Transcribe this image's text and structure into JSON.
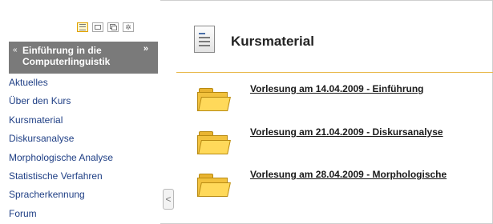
{
  "sidebar": {
    "course_title": "Einführung in die Computerlinguistik",
    "collapse_up_glyph": "«",
    "expand_glyph": "»",
    "nav_items": [
      "Aktuelles",
      "Über den Kurs",
      "Kursmaterial",
      "Diskursanalyse",
      "Morphologische Analyse",
      "Statistische Verfahren",
      "Spracherkennung",
      "Forum"
    ],
    "view_toggle_icons": [
      "list-view-icon",
      "window-view-icon",
      "multi-window-icon",
      "settings-icon"
    ],
    "collapse_button_glyph": "<"
  },
  "main": {
    "title": "Kursmaterial",
    "title_icon": "document-icon",
    "folders": [
      {
        "label": "Vorlesung am 14.04.2009 - Einführung",
        "icon": "folder-icon"
      },
      {
        "label": "Vorlesung am 21.04.2009 - Diskursanalyse",
        "icon": "folder-icon"
      },
      {
        "label": "Vorlesung am 28.04.2009 - Morphologische",
        "icon": "folder-icon"
      }
    ]
  },
  "colors": {
    "accent_divider": "#e8b84a",
    "course_header_bg": "#7a7a7a",
    "nav_link": "#1f3f85"
  }
}
